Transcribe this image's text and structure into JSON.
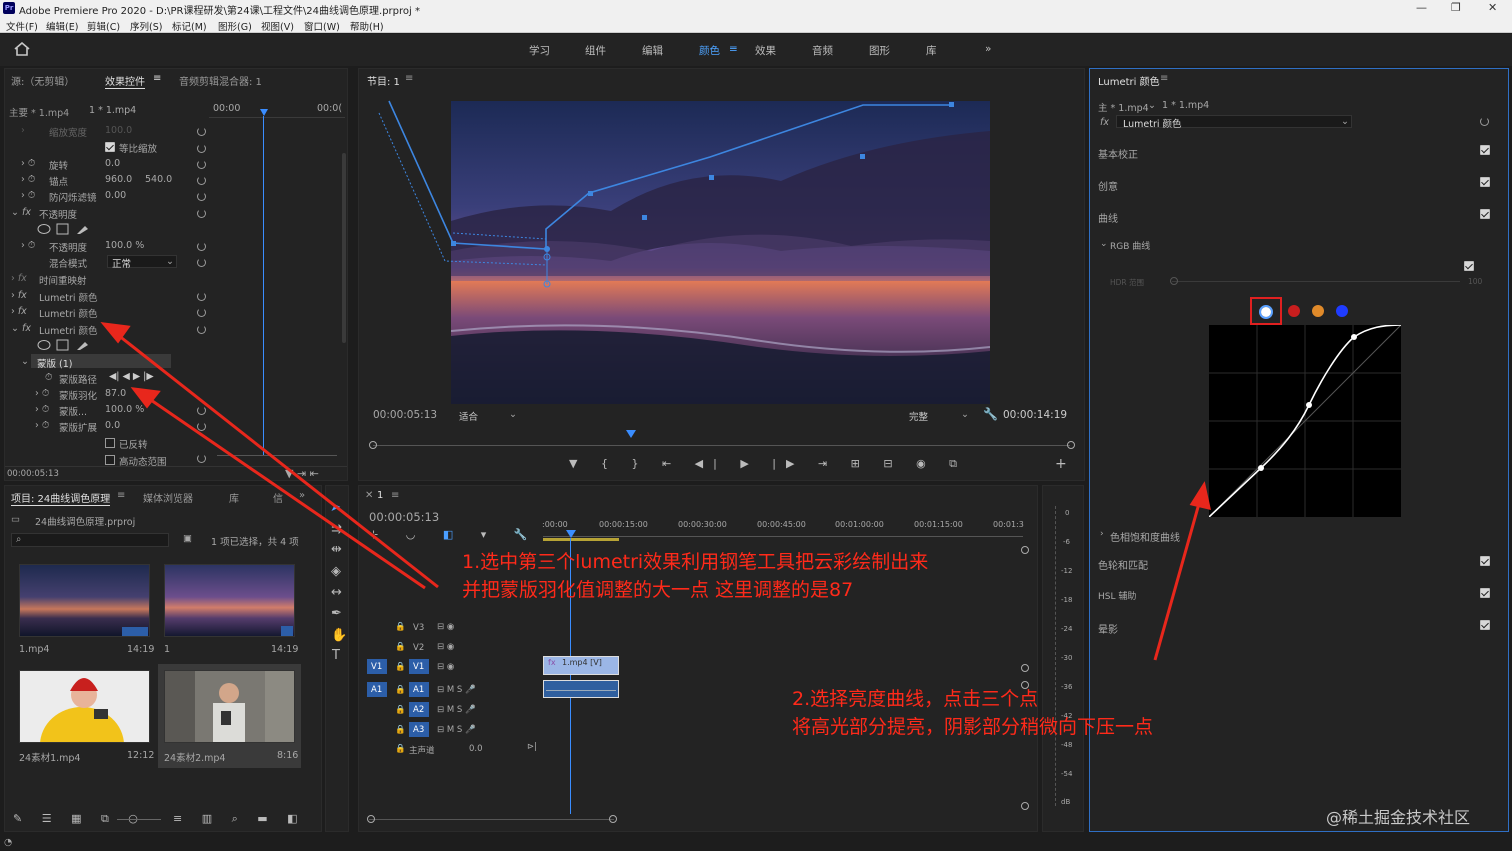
{
  "app": {
    "logo": "Pr",
    "title": "Adobe Premiere Pro 2020 - D:\\PR课程研发\\第24课\\工程文件\\24曲线调色原理.prproj *",
    "window_controls": [
      "—",
      "❐",
      "✕"
    ]
  },
  "menu": [
    "文件(F)",
    "编辑(E)",
    "剪辑(C)",
    "序列(S)",
    "标记(M)",
    "图形(G)",
    "视图(V)",
    "窗口(W)",
    "帮助(H)"
  ],
  "workspaces": {
    "items": [
      "学习",
      "组件",
      "编辑",
      "颜色",
      "效果",
      "音频",
      "图形",
      "库"
    ],
    "active": "颜色",
    "more": "»"
  },
  "effect_controls": {
    "tabs": [
      "源:（无剪辑）",
      "效果控件",
      "音频剪辑混合器: 1"
    ],
    "header_master": "主要 * 1.mp4",
    "header_clip": "1 * 1.mp4",
    "ruler_start": "00:00",
    "ruler_end": "00:0(",
    "rows": {
      "scale_width": "缩放宽度",
      "scale_width_val": "100.0",
      "uniform_scale": "等比缩放",
      "rotation": "旋转",
      "rotation_val": "0.0",
      "anchor": "锚点",
      "anchor_x": "960.0",
      "anchor_y": "540.0",
      "anti_flicker": "防闪烁滤镜",
      "anti_flicker_val": "0.00",
      "opacity_group": "不透明度",
      "opacity": "不透明度",
      "opacity_val": "100.0 %",
      "blend_mode": "混合模式",
      "blend_mode_val": "正常",
      "time_remap": "时间重映射",
      "lumetri1": "Lumetri 颜色",
      "lumetri2": "Lumetri 颜色",
      "lumetri3": "Lumetri 颜色",
      "mask": "蒙版 (1)",
      "mask_path": "蒙版路径",
      "mask_feather": "蒙版羽化",
      "mask_feather_val": "87.0",
      "mask_opacity": "蒙版...",
      "mask_opacity_val": "100.0 %",
      "mask_expand": "蒙版扩展",
      "mask_expand_val": "0.0",
      "inverted": "已反转",
      "hq": "高动态范围"
    },
    "timecode": "00:00:05:13"
  },
  "program_monitor": {
    "title": "节目: 1",
    "timecode": "00:00:05:13",
    "fit": "适合",
    "quality": "完整",
    "duration": "00:00:14:19"
  },
  "lumetri": {
    "title": "Lumetri 颜色",
    "master": "主 * 1.mp4",
    "clip": "1 * 1.mp4",
    "fx": "Lumetri 颜色",
    "sections": {
      "basic": "基本校正",
      "creative": "创意",
      "curves": "曲线",
      "rgb_curves": "RGB 曲线",
      "hdr": "HDR 范围",
      "hdr_max": "100",
      "hue_sat": "色相饱和度曲线",
      "wheels": "色轮和匹配",
      "hsl": "HSL 辅助",
      "vignette": "晕影"
    },
    "channel_colors": [
      "#ffffff",
      "#c81e1e",
      "#e08a2a",
      "#1f3cff"
    ]
  },
  "project": {
    "tabs": [
      "项目: 24曲线调色原理",
      "媒体浏览器",
      "库",
      "信"
    ],
    "file": "24曲线调色原理.prproj",
    "selection": "1 项已选择，共 4 项",
    "items": [
      {
        "name": "1.mp4",
        "dur": "14:19"
      },
      {
        "name": "1",
        "dur": "14:19"
      },
      {
        "name": "24素材1.mp4",
        "dur": "12:12"
      },
      {
        "name": "24素材2.mp4",
        "dur": "8:16"
      }
    ]
  },
  "timeline": {
    "title": "1",
    "timecode": "00:00:05:13",
    "ruler": [
      ":00:00",
      "00:00:15:00",
      "00:00:30:00",
      "00:00:45:00",
      "00:01:00:00",
      "00:01:15:00",
      "00:01:3"
    ],
    "tracks_video": [
      "V3",
      "V2",
      "V1"
    ],
    "tracks_audio": [
      "A1",
      "A2",
      "A3"
    ],
    "master": "主声道",
    "master_val": "0.0",
    "clip_label": "1.mp4 [V]",
    "meter_labels": [
      "0",
      "-6",
      "-12",
      "-18",
      "-24",
      "-30",
      "-36",
      "-42",
      "-48",
      "-54",
      "dB"
    ]
  },
  "annotations": {
    "step1_line1": "1.选中第三个lumetri效果利用钢笔工具把云彩绘制出来",
    "step1_line2": "并把蒙版羽化值调整的大一点 这里调整的是87",
    "step2_line1": "2.选择亮度曲线，点击三个点",
    "step2_line2": "将高光部分提亮，阴影部分稍微向下压一点"
  },
  "watermark": "@稀土掘金技术社区"
}
